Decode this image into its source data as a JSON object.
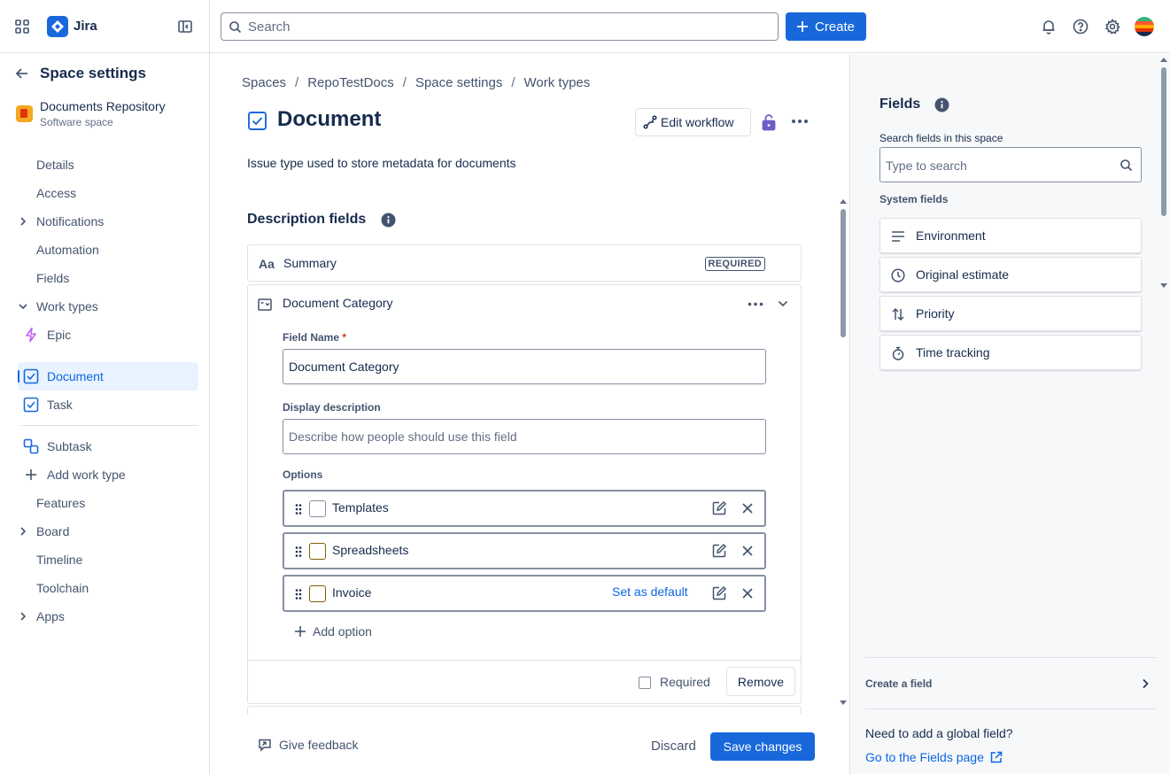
{
  "topbar": {
    "brand": "Jira",
    "search_placeholder": "Search",
    "create_label": "Create"
  },
  "sidebar": {
    "back_title": "Space settings",
    "project_name": "Documents Repository",
    "project_type": "Software space",
    "items": [
      {
        "label": "Details"
      },
      {
        "label": "Access"
      },
      {
        "label": "Notifications"
      },
      {
        "label": "Automation"
      },
      {
        "label": "Fields"
      },
      {
        "label": "Work types"
      },
      {
        "label": "Epic"
      },
      {
        "label": "Document"
      },
      {
        "label": "Task"
      },
      {
        "label": "Subtask"
      },
      {
        "label": "Add work type"
      },
      {
        "label": "Features"
      },
      {
        "label": "Board"
      },
      {
        "label": "Timeline"
      },
      {
        "label": "Toolchain"
      },
      {
        "label": "Apps"
      }
    ]
  },
  "breadcrumbs": [
    "Spaces",
    "RepoTestDocs",
    "Space settings",
    "Work types"
  ],
  "main": {
    "title": "Document",
    "edit_workflow_label": "Edit workflow",
    "description": "Issue type used to store metadata for documents",
    "description_fields_heading": "Description fields",
    "summary_icon_text": "Aa",
    "summary_label": "Summary",
    "required_badge": "REQUIRED",
    "category_label": "Document Category",
    "field_name_label": "Field Name",
    "field_name_required_mark": "*",
    "field_name_value": "Document Category",
    "display_description_label": "Display description",
    "display_description_placeholder": "Describe how people should use this field",
    "options_label": "Options",
    "options": [
      {
        "label": "Templates"
      },
      {
        "label": "Spreadsheets"
      },
      {
        "label": "Invoice"
      }
    ],
    "set_as_default_label": "Set as default",
    "add_option_label": "Add option",
    "required_checkbox_label": "Required",
    "remove_label": "Remove",
    "give_feedback_label": "Give feedback",
    "discard_label": "Discard",
    "save_changes_label": "Save changes"
  },
  "fields_panel": {
    "title": "Fields",
    "search_label": "Search fields in this space",
    "search_placeholder": "Type to search",
    "system_fields_heading": "System fields",
    "system_fields": [
      {
        "label": "Environment",
        "icon": "text-lines-icon"
      },
      {
        "label": "Original estimate",
        "icon": "clock-icon"
      },
      {
        "label": "Priority",
        "icon": "sort-arrows-icon"
      },
      {
        "label": "Time tracking",
        "icon": "stopwatch-icon"
      }
    ],
    "create_field_label": "Create a field",
    "global_field_question": "Need to add a global field?",
    "go_to_fields_link": "Go to the Fields page"
  },
  "colors": {
    "brand_blue": "#1868db",
    "link_blue": "#0c66e4",
    "active_bg": "#e9f2ff",
    "lock_purple": "#6e5dc6"
  }
}
